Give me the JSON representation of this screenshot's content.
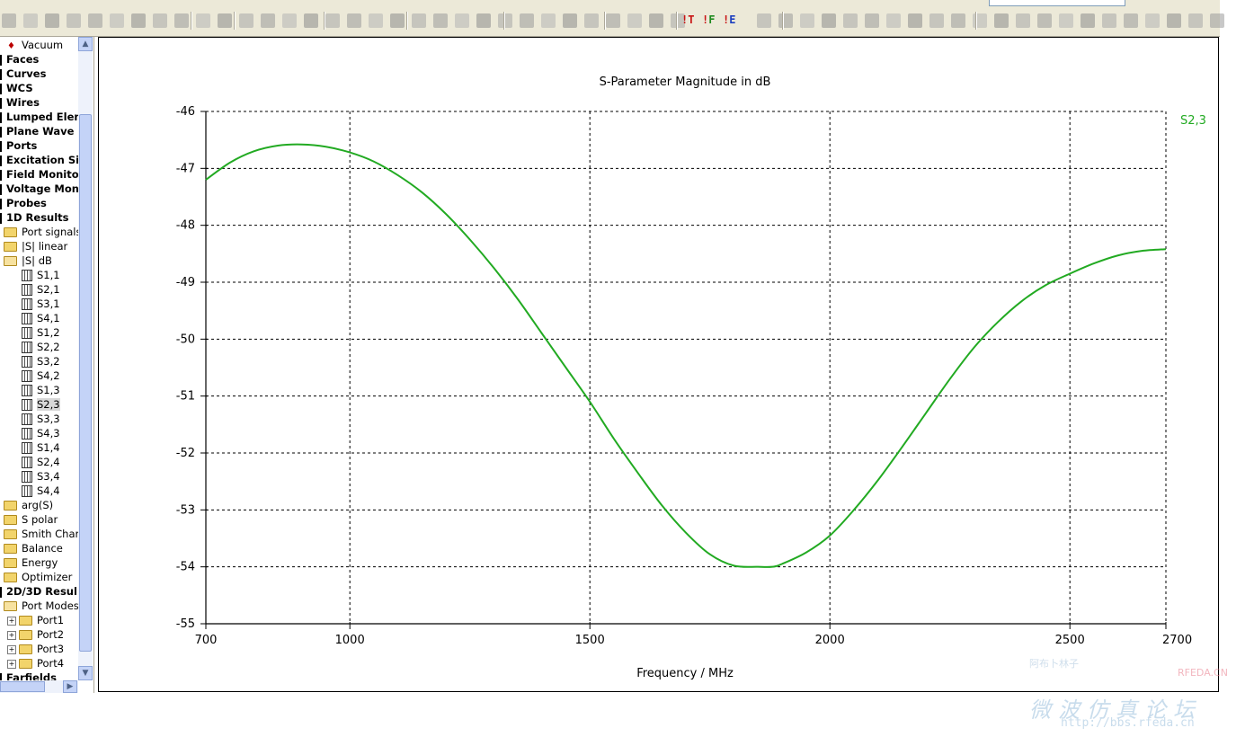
{
  "tree": {
    "vacuum": "Vacuum",
    "items": [
      {
        "label": "Faces",
        "kind": "top"
      },
      {
        "label": "Curves",
        "kind": "top"
      },
      {
        "label": "WCS",
        "kind": "top"
      },
      {
        "label": "Wires",
        "kind": "top"
      },
      {
        "label": "Lumped Elem",
        "kind": "top"
      },
      {
        "label": "Plane Wave",
        "kind": "top"
      },
      {
        "label": "Ports",
        "kind": "top"
      },
      {
        "label": "Excitation Sig",
        "kind": "top"
      },
      {
        "label": "Field Monitor",
        "kind": "top"
      },
      {
        "label": "Voltage Moni",
        "kind": "top"
      },
      {
        "label": "Probes",
        "kind": "top"
      },
      {
        "label": "1D Results",
        "kind": "top"
      },
      {
        "label": "Port signals",
        "kind": "folder"
      },
      {
        "label": "|S| linear",
        "kind": "folder"
      },
      {
        "label": "|S| dB",
        "kind": "folder-open"
      },
      {
        "label": "S1,1",
        "kind": "leaf"
      },
      {
        "label": "S2,1",
        "kind": "leaf"
      },
      {
        "label": "S3,1",
        "kind": "leaf"
      },
      {
        "label": "S4,1",
        "kind": "leaf"
      },
      {
        "label": "S1,2",
        "kind": "leaf"
      },
      {
        "label": "S2,2",
        "kind": "leaf"
      },
      {
        "label": "S3,2",
        "kind": "leaf"
      },
      {
        "label": "S4,2",
        "kind": "leaf"
      },
      {
        "label": "S1,3",
        "kind": "leaf"
      },
      {
        "label": "S2,3",
        "kind": "leaf",
        "selected": true
      },
      {
        "label": "S3,3",
        "kind": "leaf"
      },
      {
        "label": "S4,3",
        "kind": "leaf"
      },
      {
        "label": "S1,4",
        "kind": "leaf"
      },
      {
        "label": "S2,4",
        "kind": "leaf"
      },
      {
        "label": "S3,4",
        "kind": "leaf"
      },
      {
        "label": "S4,4",
        "kind": "leaf"
      },
      {
        "label": "arg(S)",
        "kind": "folder"
      },
      {
        "label": "S polar",
        "kind": "folder"
      },
      {
        "label": "Smith Char",
        "kind": "folder"
      },
      {
        "label": "Balance",
        "kind": "folder"
      },
      {
        "label": "Energy",
        "kind": "folder"
      },
      {
        "label": "Optimizer",
        "kind": "folder"
      },
      {
        "label": "2D/3D Resul",
        "kind": "top"
      },
      {
        "label": "Port Modes",
        "kind": "folder-open"
      },
      {
        "label": "Port1",
        "kind": "subfolder"
      },
      {
        "label": "Port2",
        "kind": "subfolder"
      },
      {
        "label": "Port3",
        "kind": "subfolder"
      },
      {
        "label": "Port4",
        "kind": "subfolder"
      },
      {
        "label": "Farfields",
        "kind": "top"
      }
    ]
  },
  "toolbar": {
    "trigger_labels": [
      "T",
      "F",
      "E"
    ]
  },
  "chart_data": {
    "type": "line",
    "title": "S-Parameter Magnitude in dB",
    "xlabel": "Frequency / MHz",
    "ylabel": "",
    "xlim": [
      700,
      2700
    ],
    "ylim": [
      -55,
      -46
    ],
    "xticks": [
      700,
      1000,
      1500,
      2000,
      2500,
      2700
    ],
    "yticks": [
      -46,
      -47,
      -48,
      -49,
      -50,
      -51,
      -52,
      -53,
      -54,
      -55
    ],
    "grid": true,
    "legend": "top-right",
    "series": [
      {
        "name": "S2,3",
        "color": "#22aa22",
        "x": [
          700,
          750,
          800,
          850,
          900,
          950,
          1000,
          1050,
          1100,
          1150,
          1200,
          1250,
          1300,
          1350,
          1400,
          1450,
          1500,
          1550,
          1600,
          1650,
          1700,
          1750,
          1800,
          1850,
          1880,
          1900,
          1950,
          2000,
          2050,
          2100,
          2150,
          2200,
          2250,
          2300,
          2350,
          2400,
          2450,
          2500,
          2550,
          2600,
          2650,
          2700
        ],
        "y": [
          -47.2,
          -46.9,
          -46.7,
          -46.6,
          -46.58,
          -46.62,
          -46.72,
          -46.88,
          -47.12,
          -47.42,
          -47.8,
          -48.25,
          -48.75,
          -49.3,
          -49.9,
          -50.5,
          -51.1,
          -51.75,
          -52.35,
          -52.92,
          -53.4,
          -53.78,
          -53.98,
          -54.0,
          -54.0,
          -53.95,
          -53.75,
          -53.45,
          -53.0,
          -52.48,
          -51.9,
          -51.3,
          -50.7,
          -50.15,
          -49.7,
          -49.33,
          -49.05,
          -48.85,
          -48.67,
          -48.53,
          -48.45,
          -48.42
        ]
      }
    ]
  },
  "watermark": {
    "line1": "阿布卜林子",
    "brand": "RFEDA.CN",
    "line2": "微波仿真论坛",
    "url": "http://bbs.rfeda.cn"
  }
}
